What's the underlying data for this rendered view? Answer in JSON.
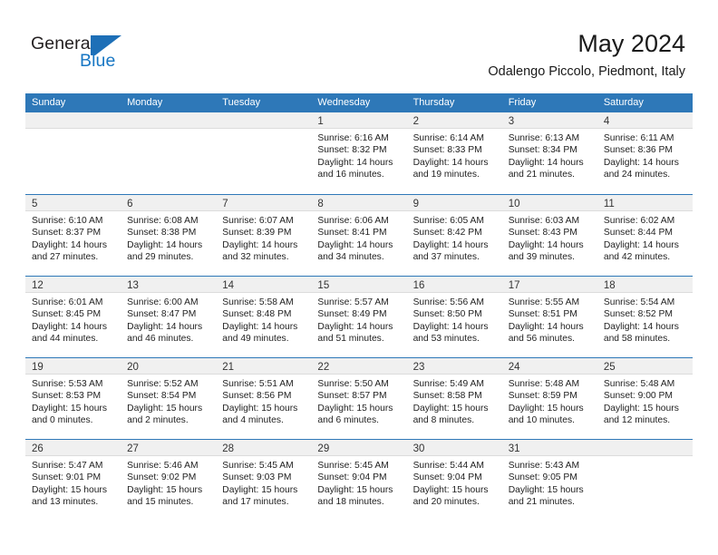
{
  "brand": {
    "name_part1": "General",
    "name_part2": "Blue",
    "mark": "triangle-logo",
    "accent_color": "#1d6fb7"
  },
  "header": {
    "month_title": "May 2024",
    "location": "Odalengo Piccolo, Piedmont, Italy"
  },
  "theme": {
    "header_bar_color": "#2e78b8",
    "day_band_color": "#f0f0f0",
    "text_color": "#222222"
  },
  "weekdays": [
    "Sunday",
    "Monday",
    "Tuesday",
    "Wednesday",
    "Thursday",
    "Friday",
    "Saturday"
  ],
  "weeks": [
    [
      {
        "day": "",
        "sunrise": "",
        "sunset": "",
        "daylight1": "",
        "daylight2": ""
      },
      {
        "day": "",
        "sunrise": "",
        "sunset": "",
        "daylight1": "",
        "daylight2": ""
      },
      {
        "day": "",
        "sunrise": "",
        "sunset": "",
        "daylight1": "",
        "daylight2": ""
      },
      {
        "day": "1",
        "sunrise": "Sunrise: 6:16 AM",
        "sunset": "Sunset: 8:32 PM",
        "daylight1": "Daylight: 14 hours",
        "daylight2": "and 16 minutes."
      },
      {
        "day": "2",
        "sunrise": "Sunrise: 6:14 AM",
        "sunset": "Sunset: 8:33 PM",
        "daylight1": "Daylight: 14 hours",
        "daylight2": "and 19 minutes."
      },
      {
        "day": "3",
        "sunrise": "Sunrise: 6:13 AM",
        "sunset": "Sunset: 8:34 PM",
        "daylight1": "Daylight: 14 hours",
        "daylight2": "and 21 minutes."
      },
      {
        "day": "4",
        "sunrise": "Sunrise: 6:11 AM",
        "sunset": "Sunset: 8:36 PM",
        "daylight1": "Daylight: 14 hours",
        "daylight2": "and 24 minutes."
      }
    ],
    [
      {
        "day": "5",
        "sunrise": "Sunrise: 6:10 AM",
        "sunset": "Sunset: 8:37 PM",
        "daylight1": "Daylight: 14 hours",
        "daylight2": "and 27 minutes."
      },
      {
        "day": "6",
        "sunrise": "Sunrise: 6:08 AM",
        "sunset": "Sunset: 8:38 PM",
        "daylight1": "Daylight: 14 hours",
        "daylight2": "and 29 minutes."
      },
      {
        "day": "7",
        "sunrise": "Sunrise: 6:07 AM",
        "sunset": "Sunset: 8:39 PM",
        "daylight1": "Daylight: 14 hours",
        "daylight2": "and 32 minutes."
      },
      {
        "day": "8",
        "sunrise": "Sunrise: 6:06 AM",
        "sunset": "Sunset: 8:41 PM",
        "daylight1": "Daylight: 14 hours",
        "daylight2": "and 34 minutes."
      },
      {
        "day": "9",
        "sunrise": "Sunrise: 6:05 AM",
        "sunset": "Sunset: 8:42 PM",
        "daylight1": "Daylight: 14 hours",
        "daylight2": "and 37 minutes."
      },
      {
        "day": "10",
        "sunrise": "Sunrise: 6:03 AM",
        "sunset": "Sunset: 8:43 PM",
        "daylight1": "Daylight: 14 hours",
        "daylight2": "and 39 minutes."
      },
      {
        "day": "11",
        "sunrise": "Sunrise: 6:02 AM",
        "sunset": "Sunset: 8:44 PM",
        "daylight1": "Daylight: 14 hours",
        "daylight2": "and 42 minutes."
      }
    ],
    [
      {
        "day": "12",
        "sunrise": "Sunrise: 6:01 AM",
        "sunset": "Sunset: 8:45 PM",
        "daylight1": "Daylight: 14 hours",
        "daylight2": "and 44 minutes."
      },
      {
        "day": "13",
        "sunrise": "Sunrise: 6:00 AM",
        "sunset": "Sunset: 8:47 PM",
        "daylight1": "Daylight: 14 hours",
        "daylight2": "and 46 minutes."
      },
      {
        "day": "14",
        "sunrise": "Sunrise: 5:58 AM",
        "sunset": "Sunset: 8:48 PM",
        "daylight1": "Daylight: 14 hours",
        "daylight2": "and 49 minutes."
      },
      {
        "day": "15",
        "sunrise": "Sunrise: 5:57 AM",
        "sunset": "Sunset: 8:49 PM",
        "daylight1": "Daylight: 14 hours",
        "daylight2": "and 51 minutes."
      },
      {
        "day": "16",
        "sunrise": "Sunrise: 5:56 AM",
        "sunset": "Sunset: 8:50 PM",
        "daylight1": "Daylight: 14 hours",
        "daylight2": "and 53 minutes."
      },
      {
        "day": "17",
        "sunrise": "Sunrise: 5:55 AM",
        "sunset": "Sunset: 8:51 PM",
        "daylight1": "Daylight: 14 hours",
        "daylight2": "and 56 minutes."
      },
      {
        "day": "18",
        "sunrise": "Sunrise: 5:54 AM",
        "sunset": "Sunset: 8:52 PM",
        "daylight1": "Daylight: 14 hours",
        "daylight2": "and 58 minutes."
      }
    ],
    [
      {
        "day": "19",
        "sunrise": "Sunrise: 5:53 AM",
        "sunset": "Sunset: 8:53 PM",
        "daylight1": "Daylight: 15 hours",
        "daylight2": "and 0 minutes."
      },
      {
        "day": "20",
        "sunrise": "Sunrise: 5:52 AM",
        "sunset": "Sunset: 8:54 PM",
        "daylight1": "Daylight: 15 hours",
        "daylight2": "and 2 minutes."
      },
      {
        "day": "21",
        "sunrise": "Sunrise: 5:51 AM",
        "sunset": "Sunset: 8:56 PM",
        "daylight1": "Daylight: 15 hours",
        "daylight2": "and 4 minutes."
      },
      {
        "day": "22",
        "sunrise": "Sunrise: 5:50 AM",
        "sunset": "Sunset: 8:57 PM",
        "daylight1": "Daylight: 15 hours",
        "daylight2": "and 6 minutes."
      },
      {
        "day": "23",
        "sunrise": "Sunrise: 5:49 AM",
        "sunset": "Sunset: 8:58 PM",
        "daylight1": "Daylight: 15 hours",
        "daylight2": "and 8 minutes."
      },
      {
        "day": "24",
        "sunrise": "Sunrise: 5:48 AM",
        "sunset": "Sunset: 8:59 PM",
        "daylight1": "Daylight: 15 hours",
        "daylight2": "and 10 minutes."
      },
      {
        "day": "25",
        "sunrise": "Sunrise: 5:48 AM",
        "sunset": "Sunset: 9:00 PM",
        "daylight1": "Daylight: 15 hours",
        "daylight2": "and 12 minutes."
      }
    ],
    [
      {
        "day": "26",
        "sunrise": "Sunrise: 5:47 AM",
        "sunset": "Sunset: 9:01 PM",
        "daylight1": "Daylight: 15 hours",
        "daylight2": "and 13 minutes."
      },
      {
        "day": "27",
        "sunrise": "Sunrise: 5:46 AM",
        "sunset": "Sunset: 9:02 PM",
        "daylight1": "Daylight: 15 hours",
        "daylight2": "and 15 minutes."
      },
      {
        "day": "28",
        "sunrise": "Sunrise: 5:45 AM",
        "sunset": "Sunset: 9:03 PM",
        "daylight1": "Daylight: 15 hours",
        "daylight2": "and 17 minutes."
      },
      {
        "day": "29",
        "sunrise": "Sunrise: 5:45 AM",
        "sunset": "Sunset: 9:04 PM",
        "daylight1": "Daylight: 15 hours",
        "daylight2": "and 18 minutes."
      },
      {
        "day": "30",
        "sunrise": "Sunrise: 5:44 AM",
        "sunset": "Sunset: 9:04 PM",
        "daylight1": "Daylight: 15 hours",
        "daylight2": "and 20 minutes."
      },
      {
        "day": "31",
        "sunrise": "Sunrise: 5:43 AM",
        "sunset": "Sunset: 9:05 PM",
        "daylight1": "Daylight: 15 hours",
        "daylight2": "and 21 minutes."
      },
      {
        "day": "",
        "sunrise": "",
        "sunset": "",
        "daylight1": "",
        "daylight2": ""
      }
    ]
  ]
}
